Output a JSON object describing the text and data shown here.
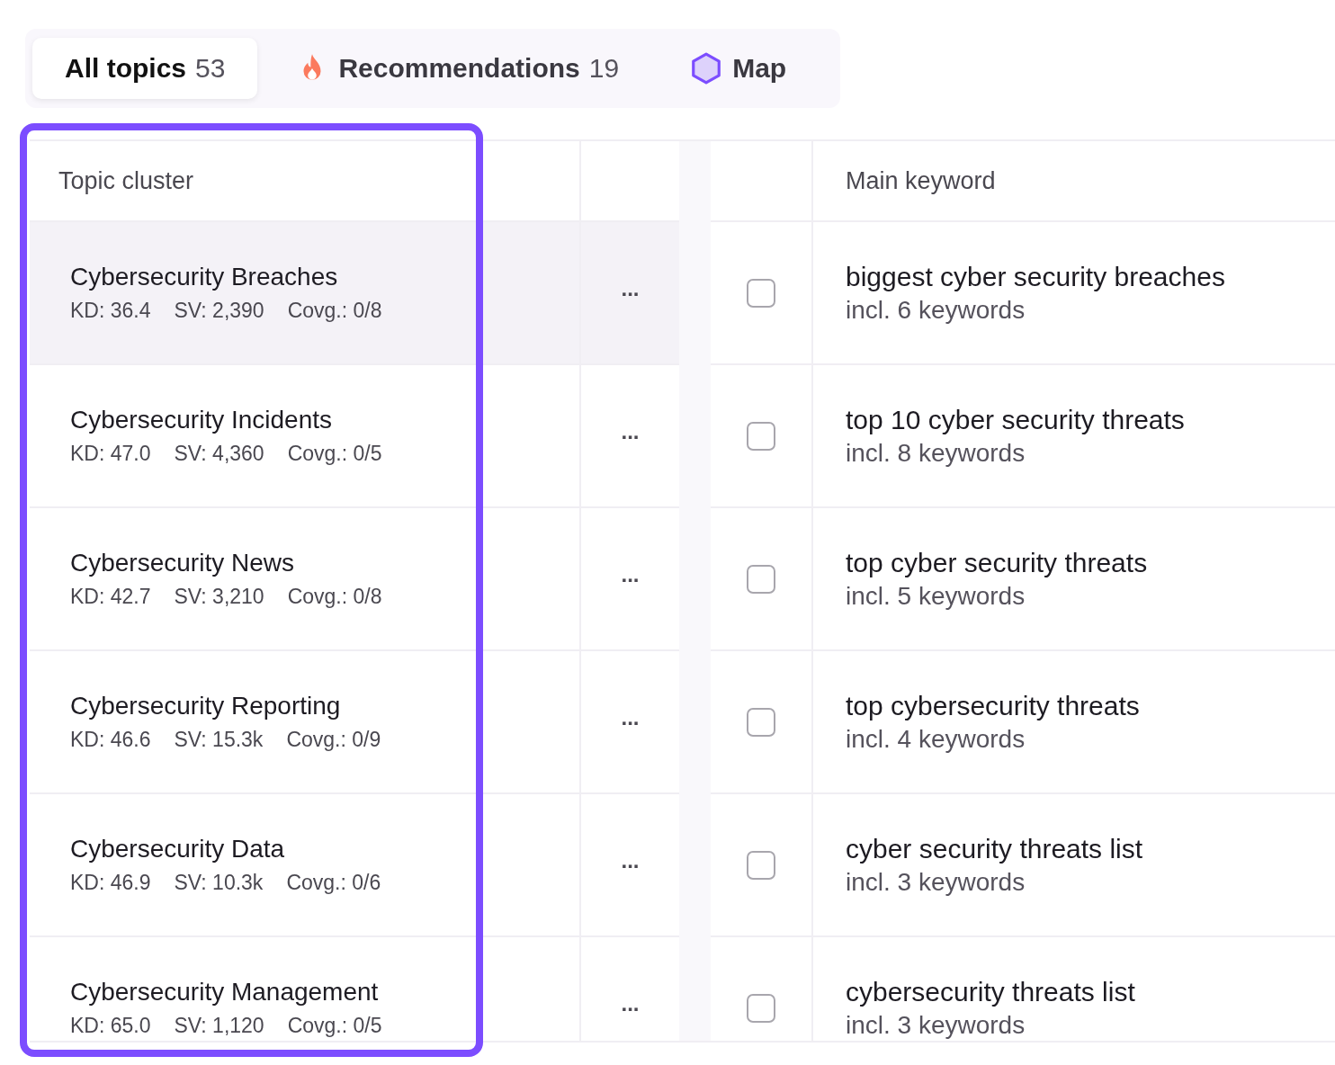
{
  "tabs": [
    {
      "label": "All topics",
      "count": "53",
      "kind": "plain",
      "selected": true
    },
    {
      "label": "Recommendations",
      "count": "19",
      "kind": "flame",
      "selected": false
    },
    {
      "label": "Map",
      "kind": "hexagon",
      "selected": false
    }
  ],
  "table": {
    "columns": [
      "Topic cluster",
      "Main keyword"
    ],
    "rows": [
      {
        "topic": "Cybersecurity Breaches",
        "stats": [
          "KD: 36.4",
          "SV: 2,390",
          "Covg.: 0/8"
        ],
        "menu": "...",
        "checked": false,
        "keyword": "biggest cyber security breaches",
        "sub": "incl. 6 keywords",
        "highlighted": true
      },
      {
        "topic": "Cybersecurity Incidents",
        "stats": [
          "KD: 47.0",
          "SV: 4,360",
          "Covg.: 0/5"
        ],
        "menu": "...",
        "checked": false,
        "keyword": "top 10 cyber security threats",
        "sub": "incl. 8 keywords",
        "highlighted": false
      },
      {
        "topic": "Cybersecurity News",
        "stats": [
          "KD: 42.7",
          "SV: 3,210",
          "Covg.: 0/8"
        ],
        "menu": "...",
        "checked": false,
        "keyword": "top cyber security threats",
        "sub": "incl. 5 keywords",
        "highlighted": false
      },
      {
        "topic": "Cybersecurity Reporting",
        "stats": [
          "KD: 46.6",
          "SV: 15.3k",
          "Covg.: 0/9"
        ],
        "menu": "...",
        "checked": false,
        "keyword": "top cybersecurity threats",
        "sub": "incl. 4 keywords",
        "highlighted": false
      },
      {
        "topic": "Cybersecurity Data",
        "stats": [
          "KD: 46.9",
          "SV: 10.3k",
          "Covg.: 0/6"
        ],
        "menu": "...",
        "checked": false,
        "keyword": "cyber security threats list",
        "sub": "incl. 3 keywords",
        "highlighted": false
      },
      {
        "topic": "Cybersecurity Management",
        "stats": [
          "KD: 65.0",
          "SV: 1,120",
          "Covg.: 0/5"
        ],
        "menu": "...",
        "checked": false,
        "keyword": "cybersecurity threats list",
        "sub": "incl. 3 keywords",
        "highlighted": false
      }
    ]
  }
}
